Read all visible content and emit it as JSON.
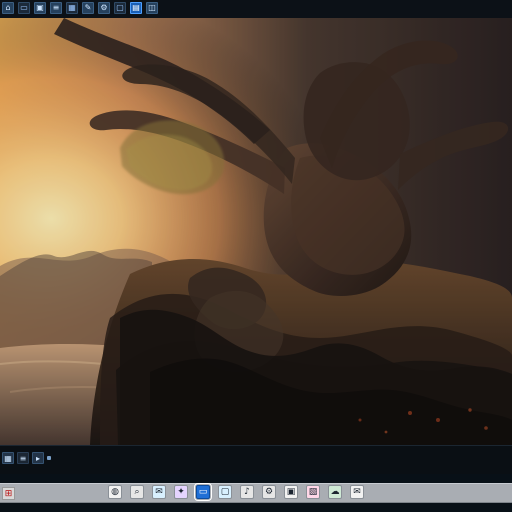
{
  "ui": {
    "top_toolbar": {
      "items": [
        {
          "name": "home-icon",
          "glyph": "⌂"
        },
        {
          "name": "folder-icon",
          "glyph": "▭"
        },
        {
          "name": "image-icon",
          "glyph": "▣"
        },
        {
          "name": "layers-icon",
          "glyph": "≡"
        },
        {
          "name": "grid-icon",
          "glyph": "▦"
        },
        {
          "name": "brush-icon",
          "glyph": "✎"
        },
        {
          "name": "settings-icon",
          "glyph": "⚙"
        },
        {
          "name": "window-icon",
          "glyph": "▢"
        },
        {
          "name": "panel-icon",
          "glyph": "▤"
        },
        {
          "name": "split-icon",
          "glyph": "◫"
        }
      ]
    },
    "bottom_panel": {
      "items": [
        {
          "name": "panel-grid-icon",
          "glyph": "▦"
        },
        {
          "name": "panel-list-icon",
          "glyph": "≡"
        },
        {
          "name": "panel-expand-icon",
          "glyph": "▸"
        }
      ]
    },
    "taskbar": {
      "start_glyph": "⊞",
      "items": [
        {
          "name": "browser-icon",
          "glyph": "◍",
          "style": "c1"
        },
        {
          "name": "search-icon",
          "glyph": "⌕",
          "style": "c6"
        },
        {
          "name": "chat-icon",
          "glyph": "✉",
          "style": "c3"
        },
        {
          "name": "app-icon",
          "glyph": "✦",
          "style": "c2"
        },
        {
          "name": "folder-icon",
          "glyph": "▭",
          "style": "blue"
        },
        {
          "name": "monitor-icon",
          "glyph": "▢",
          "style": "c3"
        },
        {
          "name": "music-icon",
          "glyph": "♪",
          "style": "c6"
        },
        {
          "name": "settings-icon",
          "glyph": "⚙",
          "style": "c6"
        },
        {
          "name": "window-icon",
          "glyph": "▣",
          "style": "c1"
        },
        {
          "name": "photos-icon",
          "glyph": "▧",
          "style": "c4"
        },
        {
          "name": "cloud-icon",
          "glyph": "☁",
          "style": "c5"
        },
        {
          "name": "mail-icon",
          "glyph": "✉",
          "style": "c1"
        }
      ]
    }
  }
}
